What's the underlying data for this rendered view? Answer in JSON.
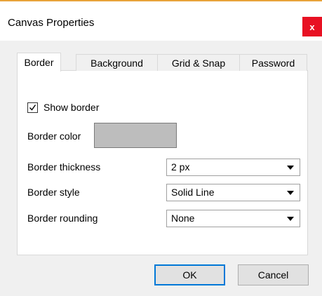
{
  "window": {
    "title": "Canvas Properties",
    "close_label": "x"
  },
  "tabs": [
    {
      "label": "Border",
      "active": true
    },
    {
      "label": "Background",
      "active": false
    },
    {
      "label": "Grid & Snap",
      "active": false
    },
    {
      "label": "Password",
      "active": false
    }
  ],
  "border": {
    "show_border": {
      "label": "Show border",
      "checked": true
    },
    "color": {
      "label": "Border color",
      "value": "#bdbdbd"
    },
    "thickness": {
      "label": "Border thickness",
      "value": "2 px"
    },
    "style": {
      "label": "Border style",
      "value": "Solid Line"
    },
    "rounding": {
      "label": "Border rounding",
      "value": "None"
    }
  },
  "buttons": {
    "ok": "OK",
    "cancel": "Cancel"
  }
}
